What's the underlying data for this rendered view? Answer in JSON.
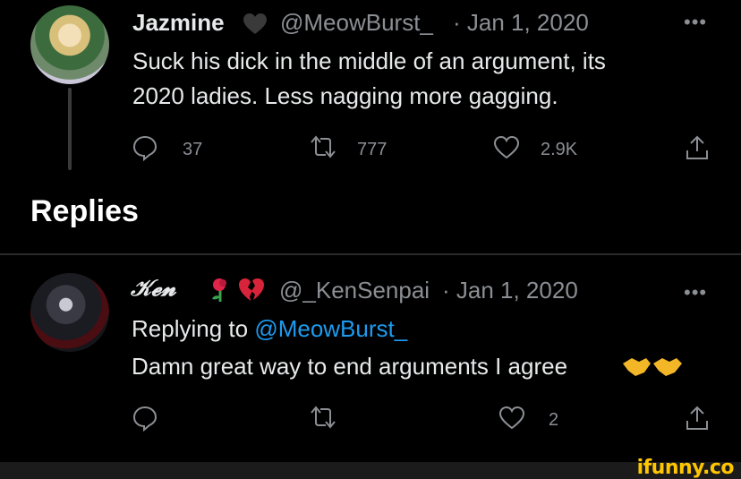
{
  "tweet": {
    "author_name": "Jazmine",
    "handle": "@MeowBurst_",
    "date": "· Jan 1, 2020",
    "text_line1": "Suck his dick in the middle of an argument, its",
    "text_line2": "2020 ladies. Less nagging more gagging.",
    "replies": "37",
    "retweets": "777",
    "likes": "2.9K",
    "more": "•••",
    "icons": {
      "badge": "black-heart-icon",
      "reply": "reply-icon",
      "retweet": "retweet-icon",
      "like": "heart-icon",
      "share": "share-icon"
    }
  },
  "section": {
    "title": "Replies"
  },
  "reply": {
    "author_name": "𝒦𝓮𝓷",
    "handle": "@_KenSenpai",
    "date": "· Jan 1, 2020",
    "replying_prefix": "Replying to",
    "replying_handle": "@MeowBurst_",
    "text": "Damn great way to end arguments I agree",
    "likes": "2",
    "more": "•••",
    "icons": {
      "badge1": "wilted-flower-icon",
      "badge2": "broken-heart-icon",
      "emoji": "handshake-icon",
      "reply": "reply-icon",
      "retweet": "retweet-icon",
      "like": "heart-icon",
      "share": "share-icon"
    }
  },
  "watermark": {
    "text": "ifunny.co"
  },
  "colors": {
    "background": "#000000",
    "text": "#e7e9ea",
    "muted": "#8b8f94",
    "link": "#1d9bf0",
    "watermark": "#ffc600"
  }
}
